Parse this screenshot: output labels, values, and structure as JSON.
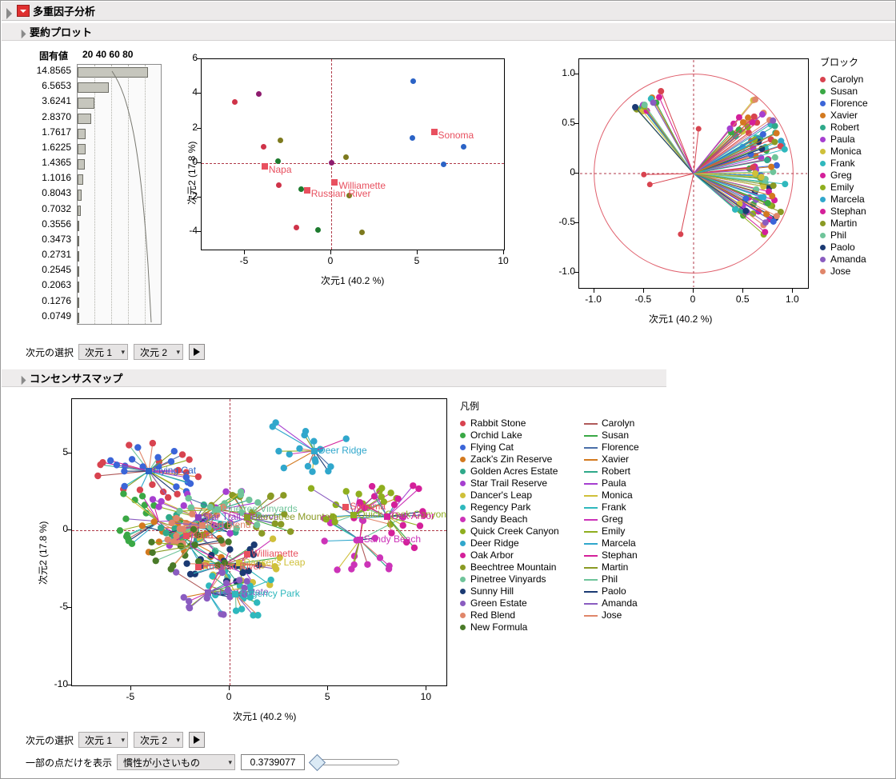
{
  "window": {
    "title": "多重因子分析",
    "menu_icon": "red-triangle-menu-icon"
  },
  "sections": {
    "summary": {
      "title": "要約プロット",
      "disclosure_icon": "outline-triangle-icon"
    },
    "consensus": {
      "title": "コンセンサスマップ",
      "disclosure_icon": "outline-triangle-icon"
    }
  },
  "scree": {
    "value_header": "固有値",
    "axis_ticks": [
      "20",
      "40",
      "60",
      "80"
    ],
    "eigenvalues": [
      "14.8565",
      "6.5653",
      "3.6241",
      "2.8370",
      "1.7617",
      "1.6225",
      "1.4365",
      "1.1016",
      "0.8043",
      "0.7032",
      "0.3556",
      "0.3473",
      "0.2731",
      "0.2545",
      "0.2063",
      "0.1276",
      "0.0749"
    ]
  },
  "chart_data": [
    {
      "type": "scatter",
      "name": "summary-score-plot",
      "title": "",
      "xlabel": "次元1  (40.2 %)",
      "ylabel": "次元2  (17.8 %)",
      "xlim": [
        -7.5,
        10
      ],
      "ylim": [
        -5,
        6
      ],
      "xticks": [
        -5,
        0,
        5,
        10
      ],
      "yticks": [
        -4,
        -2,
        0,
        2,
        4,
        6
      ],
      "grid": false,
      "reference_lines": {
        "x": 0,
        "y": 0
      },
      "points": [
        {
          "x": -5.6,
          "y": 3.55,
          "color": "#cf3349"
        },
        {
          "x": -4.2,
          "y": 4.0,
          "color": "#8e1b6e"
        },
        {
          "x": -3.9,
          "y": 0.95,
          "color": "#cf3349"
        },
        {
          "x": -2.95,
          "y": 1.33,
          "color": "#7d7a1e"
        },
        {
          "x": -3.1,
          "y": 0.1,
          "color": "#1d7a2e"
        },
        {
          "x": -3.05,
          "y": -1.28,
          "color": "#cf3349"
        },
        {
          "x": -1.75,
          "y": -1.52,
          "color": "#1d7a2e"
        },
        {
          "x": -2.0,
          "y": -3.75,
          "color": "#cf3349"
        },
        {
          "x": -0.75,
          "y": -3.85,
          "color": "#1d7a2e"
        },
        {
          "x": 0.0,
          "y": 0.0,
          "color": "#8e1b6e"
        },
        {
          "x": 0.85,
          "y": 0.33,
          "color": "#7d7a1e"
        },
        {
          "x": 1.05,
          "y": -1.88,
          "color": "#7d7a1e"
        },
        {
          "x": 1.8,
          "y": -4.0,
          "color": "#7d7a1e"
        },
        {
          "x": 4.75,
          "y": 4.75,
          "color": "#2b63c6"
        },
        {
          "x": 4.7,
          "y": 1.45,
          "color": "#2b63c6"
        },
        {
          "x": 7.65,
          "y": 0.95,
          "color": "#2b63c6"
        },
        {
          "x": 6.5,
          "y": -0.1,
          "color": "#2b63c6"
        }
      ],
      "group_markers": [
        {
          "label": "Napa",
          "x": -3.85,
          "y": -0.18,
          "color": "#e8505f"
        },
        {
          "label": "Russian River",
          "x": -1.4,
          "y": -1.6,
          "color": "#e8505f"
        },
        {
          "label": "Williamette",
          "x": 0.2,
          "y": -1.1,
          "color": "#e8505f"
        },
        {
          "label": "Sonoma",
          "x": 5.95,
          "y": 1.78,
          "color": "#e8505f"
        }
      ]
    },
    {
      "type": "scatter",
      "name": "correlation-circle-plot",
      "title": "",
      "xlabel": "次元1  (40.2 %)",
      "ylabel": "",
      "xlim": [
        -1.15,
        1.15
      ],
      "ylim": [
        -1.15,
        1.15
      ],
      "xticks": [
        -1.0,
        -0.5,
        0,
        0.5,
        1.0
      ],
      "yticks": [
        -1.0,
        -0.5,
        0,
        0.5,
        1.0
      ],
      "unit_circle": true,
      "grid": false,
      "reference_lines": {
        "x": 0,
        "y": 0
      },
      "note": "loading vectors from origin to points on/inside unit circle, colored by block"
    },
    {
      "type": "scatter",
      "name": "consensus-map-plot",
      "title": "",
      "xlabel": "次元1  (40.2 %)",
      "ylabel": "次元2  (17.8 %)",
      "xlim": [
        -8,
        11
      ],
      "ylim": [
        -10,
        8.5
      ],
      "xticks": [
        -5,
        0,
        5,
        10
      ],
      "yticks": [
        -10,
        -5,
        0,
        5
      ],
      "grid": false,
      "reference_lines": {
        "x": 0,
        "y": 0
      },
      "note": "consensus (square) points per wine connected by lines to each block's individual point",
      "consensus_labels": [
        {
          "label": "Flying Cat",
          "x": -4.1,
          "y": 3.85,
          "color": "#2b63c6"
        },
        {
          "label": "Pinetree Vinyards",
          "x": -0.6,
          "y": 1.35,
          "color": "#6fc49a"
        },
        {
          "label": "Star Trail Reserve",
          "x": -1.6,
          "y": 0.85,
          "color": "#8c3fc0"
        },
        {
          "label": "Beechtree Mountain",
          "x": 0.9,
          "y": 0.85,
          "color": "#8a9a24"
        },
        {
          "label": "Red Blend",
          "x": -1.4,
          "y": 0.35,
          "color": "#e0866a"
        },
        {
          "label": "Napa",
          "x": -2.2,
          "y": -0.35,
          "color": "#e8505f"
        },
        {
          "label": "Deer Ridge",
          "x": 4.3,
          "y": 5.15,
          "color": "#30a7cc"
        },
        {
          "label": "Sonoma",
          "x": 5.9,
          "y": 1.5,
          "color": "#e8505f"
        },
        {
          "label": "Quick Creek Canyon",
          "x": 6.3,
          "y": 1.0,
          "color": "#8fae1f"
        },
        {
          "label": "Oak Arbor",
          "x": 8.0,
          "y": 0.9,
          "color": "#d4209a"
        },
        {
          "label": "Sandy Beach",
          "x": 6.6,
          "y": -0.6,
          "color": "#cc33b8"
        },
        {
          "label": "Williamette",
          "x": 0.9,
          "y": -1.55,
          "color": "#e8505f"
        },
        {
          "label": "Dancer's Leap",
          "x": 0.5,
          "y": -2.1,
          "color": "#cfc03a"
        },
        {
          "label": "Russian River",
          "x": -1.6,
          "y": -2.35,
          "color": "#e8505f"
        },
        {
          "label": "Green Estate",
          "x": -1.1,
          "y": -4.0,
          "color": "#8a5cc0"
        },
        {
          "label": "Regency Park",
          "x": 0.3,
          "y": -4.1,
          "color": "#2fb8bd"
        }
      ]
    }
  ],
  "block_legend": {
    "title": "ブロック",
    "items": [
      {
        "label": "Carolyn",
        "color": "#d8434f"
      },
      {
        "label": "Susan",
        "color": "#3aa845"
      },
      {
        "label": "Florence",
        "color": "#3b65d8"
      },
      {
        "label": "Xavier",
        "color": "#d3791f"
      },
      {
        "label": "Robert",
        "color": "#2fa98a"
      },
      {
        "label": "Paula",
        "color": "#a63fd0"
      },
      {
        "label": "Monica",
        "color": "#cfc03a"
      },
      {
        "label": "Frank",
        "color": "#2fb8bd"
      },
      {
        "label": "Greg",
        "color": "#d4209a"
      },
      {
        "label": "Emily",
        "color": "#8fae1f"
      },
      {
        "label": "Marcela",
        "color": "#30a7cc"
      },
      {
        "label": "Stephan",
        "color": "#d4209a"
      },
      {
        "label": "Martin",
        "color": "#8a9a24"
      },
      {
        "label": "Phil",
        "color": "#6fc49a"
      },
      {
        "label": "Paolo",
        "color": "#1b3a73"
      },
      {
        "label": "Amanda",
        "color": "#8a5cc0"
      },
      {
        "label": "Jose",
        "color": "#e0866a"
      }
    ]
  },
  "consensus_legend": {
    "title": "凡例",
    "wines": [
      {
        "label": "Rabbit Stone",
        "color": "#d8434f"
      },
      {
        "label": "Orchid Lake",
        "color": "#3aa845"
      },
      {
        "label": "Flying Cat",
        "color": "#3b65d8"
      },
      {
        "label": "Zack's Zin Reserve",
        "color": "#d3791f"
      },
      {
        "label": "Golden Acres Estate",
        "color": "#2fa98a"
      },
      {
        "label": "Star Trail Reserve",
        "color": "#a63fd0"
      },
      {
        "label": "Dancer's Leap",
        "color": "#cfc03a"
      },
      {
        "label": "Regency Park",
        "color": "#2fb8bd"
      },
      {
        "label": "Sandy Beach",
        "color": "#cc33b8"
      },
      {
        "label": "Quick Creek Canyon",
        "color": "#8fae1f"
      },
      {
        "label": "Deer Ridge",
        "color": "#30a7cc"
      },
      {
        "label": "Oak Arbor",
        "color": "#d4209a"
      },
      {
        "label": "Beechtree Mountain",
        "color": "#8a9a24"
      },
      {
        "label": "Pinetree Vinyards",
        "color": "#6fc49a"
      },
      {
        "label": "Sunny Hill",
        "color": "#1b3a73"
      },
      {
        "label": "Green Estate",
        "color": "#8a5cc0"
      },
      {
        "label": "Red Blend",
        "color": "#e0866a"
      },
      {
        "label": "New Formula",
        "color": "#4a7a28"
      }
    ],
    "blocks": [
      {
        "label": "Carolyn",
        "color": "#b05a5a"
      },
      {
        "label": "Susan",
        "color": "#3aa845"
      },
      {
        "label": "Florence",
        "color": "#4a6fa8"
      },
      {
        "label": "Xavier",
        "color": "#d3791f"
      },
      {
        "label": "Robert",
        "color": "#2fa98a"
      },
      {
        "label": "Paula",
        "color": "#a63fd0"
      },
      {
        "label": "Monica",
        "color": "#cfc03a"
      },
      {
        "label": "Frank",
        "color": "#2fb8bd"
      },
      {
        "label": "Greg",
        "color": "#cc33b8"
      },
      {
        "label": "Emily",
        "color": "#8fae1f"
      },
      {
        "label": "Marcela",
        "color": "#30a7cc"
      },
      {
        "label": "Stephan",
        "color": "#d4209a"
      },
      {
        "label": "Martin",
        "color": "#8a9a24"
      },
      {
        "label": "Phil",
        "color": "#6fc49a"
      },
      {
        "label": "Paolo",
        "color": "#1b3a73"
      },
      {
        "label": "Amanda",
        "color": "#8a5cc0"
      },
      {
        "label": "Jose",
        "color": "#e0866a"
      }
    ]
  },
  "controls": {
    "dim_select_label": "次元の選択",
    "dim_x_value": "次元 1",
    "dim_y_value": "次元 2",
    "go_button_icon": "right-arrow-icon",
    "subset_label": "一部の点だけを表示",
    "subset_value": "慣性が小さいもの",
    "subset_number": "0.3739077"
  },
  "colors": {
    "accent_red": "#e8505f",
    "reference_line": "#b03a48",
    "circle": "#e0606d",
    "header_bg": "#eeecec"
  }
}
